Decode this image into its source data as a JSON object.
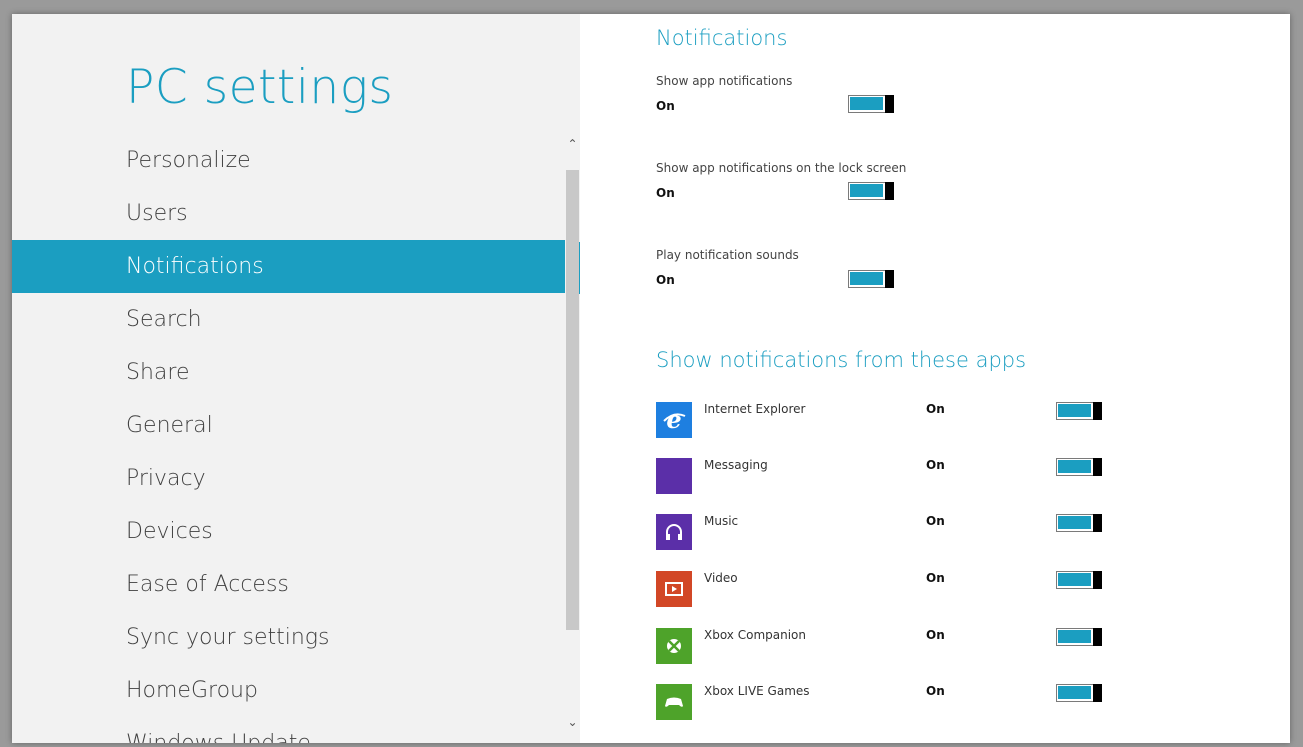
{
  "app": {
    "title": "PC settings"
  },
  "nav": {
    "items": [
      {
        "label": "Personalize",
        "selected": false
      },
      {
        "label": "Users",
        "selected": false
      },
      {
        "label": "Notifications",
        "selected": true
      },
      {
        "label": "Search",
        "selected": false
      },
      {
        "label": "Share",
        "selected": false
      },
      {
        "label": "General",
        "selected": false
      },
      {
        "label": "Privacy",
        "selected": false
      },
      {
        "label": "Devices",
        "selected": false
      },
      {
        "label": "Ease of Access",
        "selected": false
      },
      {
        "label": "Sync your settings",
        "selected": false
      },
      {
        "label": "HomeGroup",
        "selected": false
      },
      {
        "label": "Windows Update",
        "selected": false
      }
    ]
  },
  "notifications": {
    "heading": "Notifications",
    "settings": [
      {
        "label": "Show app notifications",
        "state": "On",
        "enabled": true
      },
      {
        "label": "Show app notifications on the lock screen",
        "state": "On",
        "enabled": true
      },
      {
        "label": "Play notification sounds",
        "state": "On",
        "enabled": true
      }
    ]
  },
  "apps_section": {
    "heading": "Show notifications from these apps",
    "apps": [
      {
        "name": "Internet Explorer",
        "state": "On",
        "icon": "internet-explorer-icon",
        "tile_color": "#1e7fe0"
      },
      {
        "name": "Messaging",
        "state": "On",
        "icon": "messaging-icon",
        "tile_color": "#5b2fa8"
      },
      {
        "name": "Music",
        "state": "On",
        "icon": "headphones-icon",
        "tile_color": "#5b2fa8"
      },
      {
        "name": "Video",
        "state": "On",
        "icon": "video-play-icon",
        "tile_color": "#d24726"
      },
      {
        "name": "Xbox Companion",
        "state": "On",
        "icon": "xbox-icon",
        "tile_color": "#4ea32a"
      },
      {
        "name": "Xbox LIVE Games",
        "state": "On",
        "icon": "gamepad-icon",
        "tile_color": "#4ea32a"
      }
    ]
  },
  "colors": {
    "accent": "#1b9ec1",
    "left_pane_bg": "#f2f2f2",
    "toggle_thumb": "#000000"
  }
}
